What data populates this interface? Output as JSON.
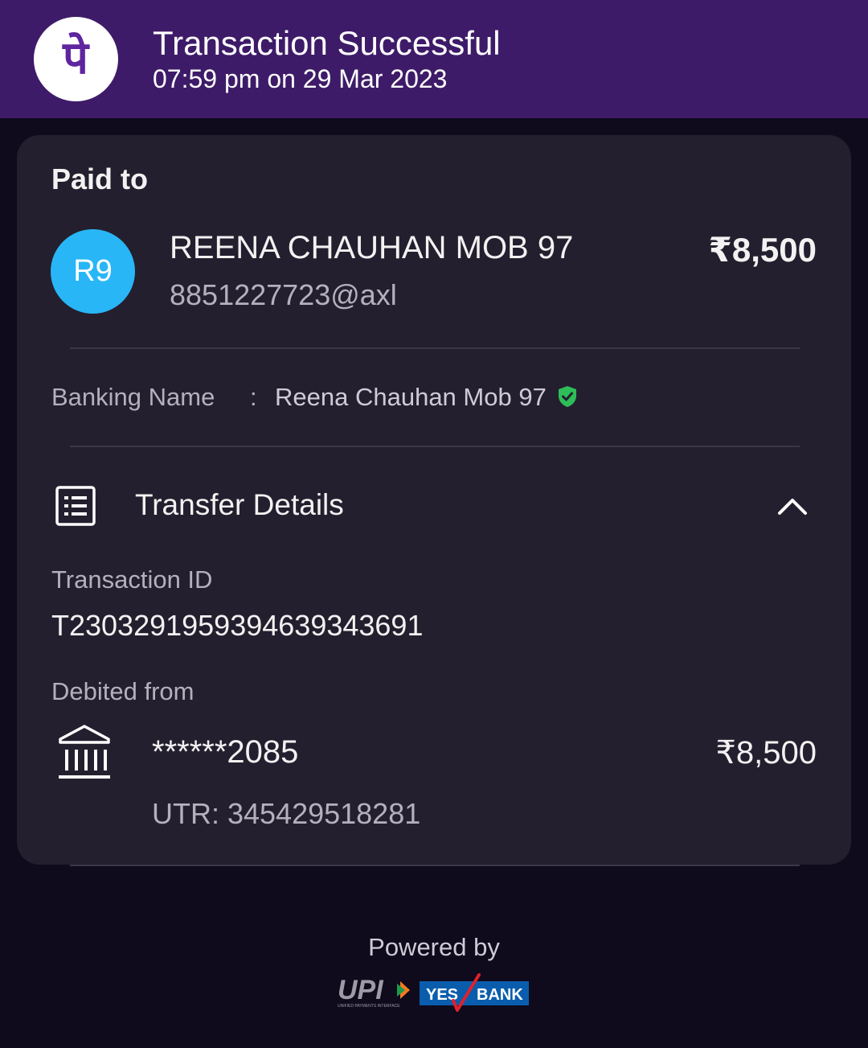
{
  "header": {
    "logo_glyph": "पे",
    "title": "Transaction Successful",
    "datetime": "07:59 pm on 29 Mar 2023",
    "background": "#3e1b68"
  },
  "paid_to": {
    "heading": "Paid to",
    "avatar_initials": "R9",
    "avatar_color": "#29b6f6",
    "name": "REENA CHAUHAN MOB 97",
    "vpa": "8851227723@axl",
    "amount": "₹8,500"
  },
  "banking": {
    "label": "Banking Name",
    "separator": ":",
    "value": "Reena Chauhan Mob 97",
    "verified_icon": "shield-check-icon",
    "verified_color": "#2ebd59"
  },
  "transfer_details": {
    "title": "Transfer Details",
    "icon": "receipt-list-icon",
    "toggle_icon": "chevron-up-icon",
    "transaction_id_label": "Transaction ID",
    "transaction_id": "T2303291959394639343691",
    "debited_from_label": "Debited from",
    "bank_icon": "bank-building-icon",
    "account": "******2085",
    "amount": "₹8,500",
    "utr": "UTR: 345429518281"
  },
  "footer": {
    "powered_by": "Powered by",
    "upi_logo_text": "UPI",
    "upi_logo_tagline": "UNIFIED PAYMENTS INTERFACE",
    "bank_logo_left": "YES",
    "bank_logo_right": "BANK"
  }
}
